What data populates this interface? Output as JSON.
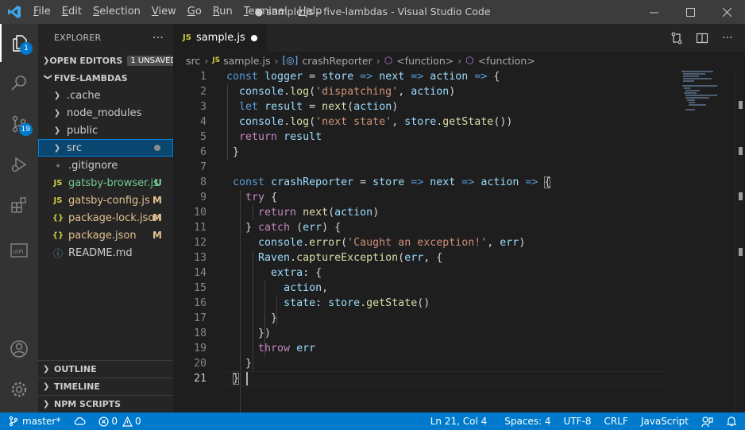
{
  "titlebar": {
    "menu": [
      "File",
      "Edit",
      "Selection",
      "View",
      "Go",
      "Run",
      "Terminal",
      "Help"
    ],
    "menu_mnemonics": [
      "F",
      "E",
      "S",
      "V",
      "G",
      "R",
      "T",
      "H"
    ],
    "window_title": "● sample.js - five-lambdas - Visual Studio Code"
  },
  "activitybar": {
    "explorer_badge": "1",
    "scm_badge": "19"
  },
  "sidebar": {
    "header": "EXPLORER",
    "more": "···",
    "open_editors": "OPEN EDITORS",
    "unsaved_badge": "1 UNSAVED",
    "project": "FIVE-LAMBDAS",
    "items": [
      {
        "label": ".cache",
        "type": "folder"
      },
      {
        "label": "node_modules",
        "type": "folder"
      },
      {
        "label": "public",
        "type": "folder"
      },
      {
        "label": "src",
        "type": "folder",
        "selected": true
      },
      {
        "label": ".gitignore",
        "type": "file"
      },
      {
        "label": "gatsby-browser.js",
        "type": "js",
        "status": "U"
      },
      {
        "label": "gatsby-config.js",
        "type": "js",
        "status": "M"
      },
      {
        "label": "package-lock.json",
        "type": "json",
        "status": "M"
      },
      {
        "label": "package.json",
        "type": "json",
        "status": "M"
      },
      {
        "label": "README.md",
        "type": "info"
      }
    ],
    "outline": "OUTLINE",
    "timeline": "TIMELINE",
    "npm_scripts": "NPM SCRIPTS"
  },
  "editor": {
    "tab_label": "sample.js",
    "tab_icon": "JS",
    "breadcrumbs": [
      "src",
      "sample.js",
      "crashReporter",
      "<function>",
      "<function>"
    ],
    "line_numbers": [
      "1",
      "2",
      "3",
      "4",
      "5",
      "6",
      "7",
      "8",
      "9",
      "10",
      "11",
      "12",
      "13",
      "14",
      "15",
      "16",
      "17",
      "18",
      "19",
      "20",
      "21"
    ],
    "current_line": 21
  },
  "statusbar": {
    "branch": "master*",
    "problems": "0",
    "warnings": "0",
    "position": "Ln 21, Col 4",
    "spaces": "Spaces: 4",
    "encoding": "UTF-8",
    "eol": "CRLF",
    "language": "JavaScript"
  },
  "colors": {
    "accent": "#007acc",
    "keyword": "#569cd6",
    "control": "#c586c0",
    "variable": "#9cdcfe",
    "function": "#dcdcaa",
    "string": "#ce9178",
    "git_untracked": "#73c991",
    "git_modified": "#e2c08d"
  }
}
